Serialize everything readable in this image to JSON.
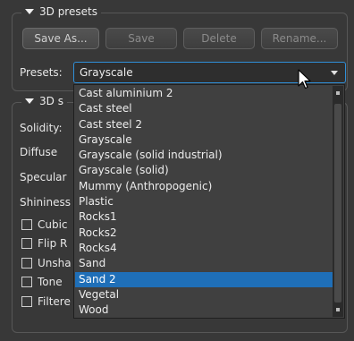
{
  "presets_group": {
    "title": "3D presets",
    "buttons": [
      "Save As...",
      "Save",
      "Delete",
      "Rename..."
    ],
    "presets_label": "Presets:",
    "selected_value": "Grayscale"
  },
  "settings_group": {
    "title": "3D s",
    "labels": [
      "Solidity:",
      "Diffuse",
      "Specular",
      "Shininess"
    ],
    "checkboxes": [
      "Cubic",
      "Flip R",
      "Unsha",
      "Tone",
      "Filtere"
    ]
  },
  "dropdown": {
    "items": [
      "Cast aluminium 2",
      "Cast steel",
      "Cast steel 2",
      "Grayscale",
      "Grayscale (solid industrial)",
      "Grayscale (solid)",
      "Mummy (Anthropogenic)",
      "Plastic",
      "Rocks1",
      "Rocks2",
      "Rocks4",
      "Sand",
      "Sand 2",
      "Vegetal",
      "Wood"
    ],
    "highlighted": "Sand 2"
  }
}
